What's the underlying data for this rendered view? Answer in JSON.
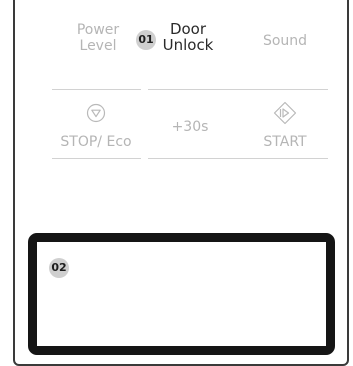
{
  "panel": {
    "buttons": {
      "power_level_line1": "Power",
      "power_level_line2": "Level",
      "door_unlock_line1": "Door",
      "door_unlock_line2": "Unlock",
      "sound": "Sound",
      "stop_eco": "STOP/ Eco",
      "plus_30s": "+30s",
      "start": "START"
    },
    "icons": {
      "stop_eco_icon": "down-triangle-circle-icon",
      "start_icon": "diamond-start-icon"
    }
  },
  "callouts": {
    "first": "01",
    "second": "02"
  }
}
